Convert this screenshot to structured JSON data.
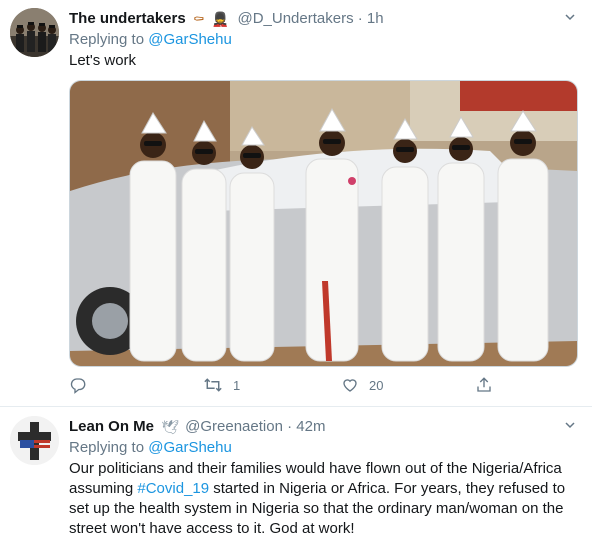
{
  "tweets": [
    {
      "display_name": "The undertakers",
      "name_emojis": [
        "⚰",
        "💂"
      ],
      "handle": "@D_Undertakers",
      "time": "· 1h",
      "replying_prefix": "Replying to ",
      "replying_to": "@GarShehu",
      "text": "Let's work",
      "replies": "",
      "retweets": "1",
      "likes": "20"
    },
    {
      "display_name": "Lean On Me",
      "name_emojis": [
        "🕊"
      ],
      "handle": "@Greenaetion",
      "time": "· 42m",
      "replying_prefix": "Replying to ",
      "replying_to": "@GarShehu",
      "text_before": "Our politicians and their families would have flown out of the Nigeria/Africa assuming ",
      "hashtag": "#Covid_19",
      "text_after": " started in Nigeria or Africa. For years, they refused to set up the health system in Nigeria so that the ordinary man/woman on the street won't have access to it. God at work!"
    }
  ],
  "colors": {
    "link": "#1b95e0",
    "secondary": "#657786",
    "text": "#14171a",
    "divider": "#e6ecf0"
  },
  "icons": [
    "reply-icon",
    "retweet-icon",
    "like-icon",
    "share-icon",
    "chevron-down-icon"
  ]
}
